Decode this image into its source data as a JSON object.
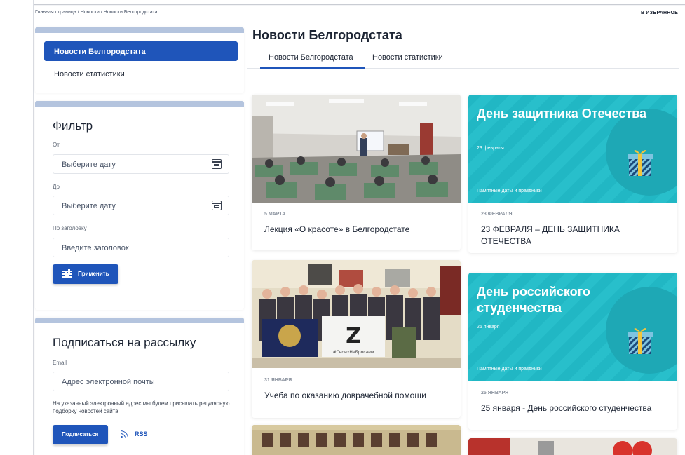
{
  "breadcrumb": [
    "Главная страница",
    "/",
    "Новости",
    "/",
    "Новости Белгородстата"
  ],
  "favorites": "В ИЗБРАННОЕ",
  "sidebar_nav": {
    "active": "Новости Белгородстата",
    "item": "Новости статистики"
  },
  "filter": {
    "title": "Фильтр",
    "from_label": "От",
    "from_placeholder": "Выберите дату",
    "to_label": "До",
    "to_placeholder": "Выберите дату",
    "title_label": "По заголовку",
    "title_placeholder": "Введите заголовок",
    "apply": "Применить"
  },
  "subscribe": {
    "title": "Подписаться на рассылку",
    "email_label": "Email",
    "email_placeholder": "Адрес электронной почты",
    "note": "На указанный электронный адрес мы будем присылать регулярную подборку новостей сайта",
    "button": "Подписаться",
    "rss": "RSS"
  },
  "main": {
    "title": "Новости Белгородстата",
    "tabs": [
      "Новости Белгородстата",
      "Новости статистики"
    ]
  },
  "news": [
    {
      "date": "5 МАРТА",
      "title": "Лекция «О красоте» в Белгородстате"
    },
    {
      "promo_title": "День защитника Отечества",
      "promo_date": "23 февраля",
      "promo_foot": "Памятные даты и праздники",
      "date": "23 ФЕВРАЛЯ",
      "title": "23 ФЕВРАЛЯ – ДЕНЬ ЗАЩИТНИКА ОТЕЧЕСТВА"
    },
    {
      "date": "31 ЯНВАРЯ",
      "title": "Учеба по оказанию доврачебной помощи",
      "banner_text": "#СвоихНеБросаем"
    },
    {
      "promo_title": "День российского студенчества",
      "promo_date": "25 января",
      "promo_foot": "Памятные даты и праздники",
      "date": "25 ЯНВАРЯ",
      "title": "25 января - День российского студенчества"
    }
  ],
  "colors": {
    "accent": "#1f55ba",
    "card_bar": "#b4c4de",
    "promo": "#21b7c4"
  }
}
